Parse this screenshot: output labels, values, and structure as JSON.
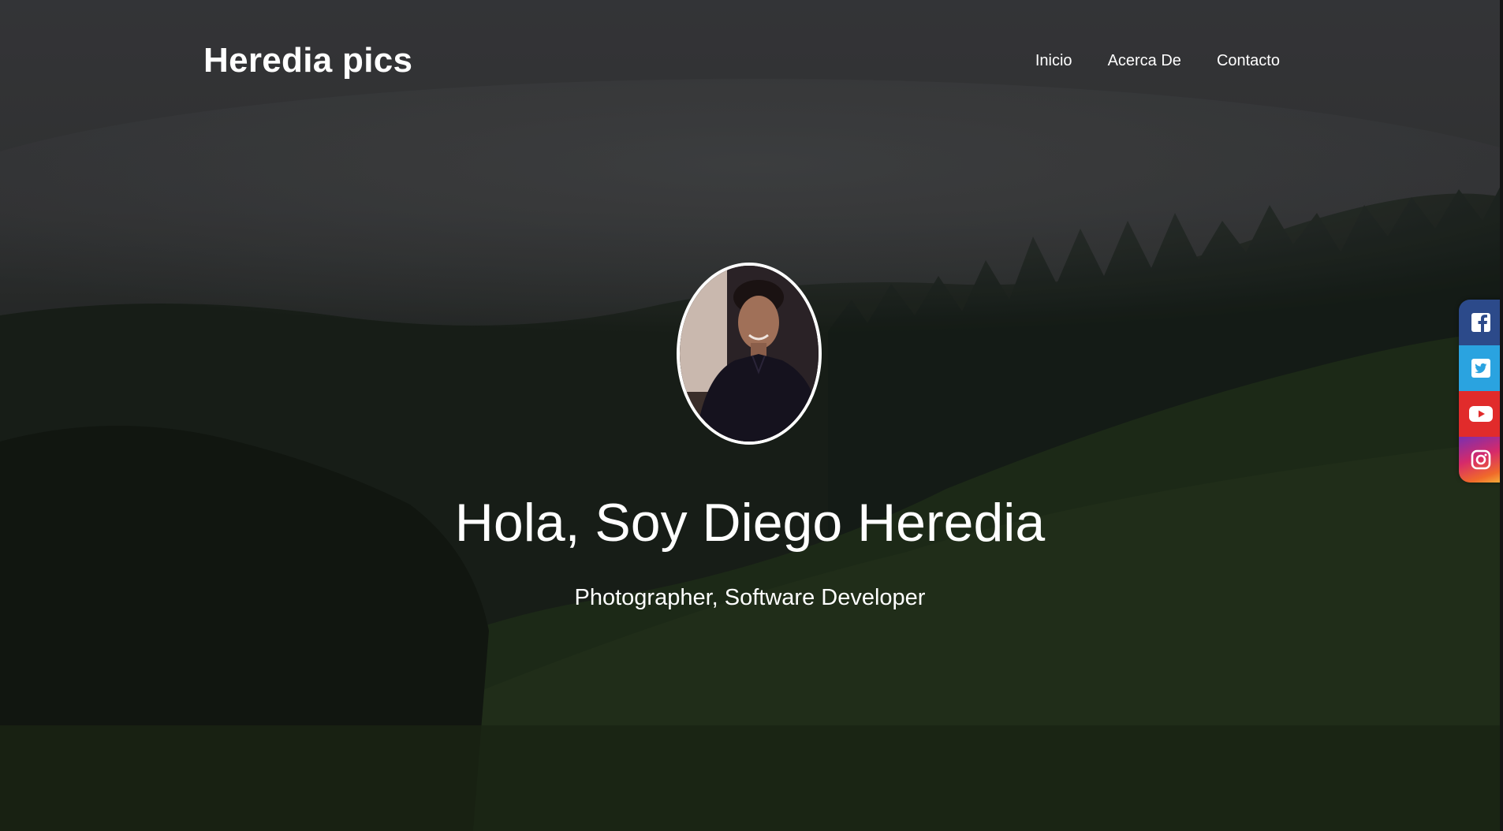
{
  "navbar": {
    "brand": "Heredia pics",
    "links": [
      "Inicio",
      "Acerca De",
      "Contacto"
    ]
  },
  "hero": {
    "title": "Hola, Soy Diego Heredia",
    "subtitle": "Photographer, Software Developer",
    "avatar_icon": "portrait-photo"
  },
  "social": {
    "items": [
      {
        "icon": "facebook-icon",
        "color": "#2c4a8a"
      },
      {
        "icon": "twitter-icon",
        "color": "#2aa3e0"
      },
      {
        "icon": "youtube-icon",
        "color": "#e12b2b"
      },
      {
        "icon": "instagram-icon",
        "color": "#d62a6a"
      }
    ]
  },
  "colors": {
    "text": "#ffffff",
    "sky": "#3a3b3d",
    "forest": "#1b2619"
  }
}
